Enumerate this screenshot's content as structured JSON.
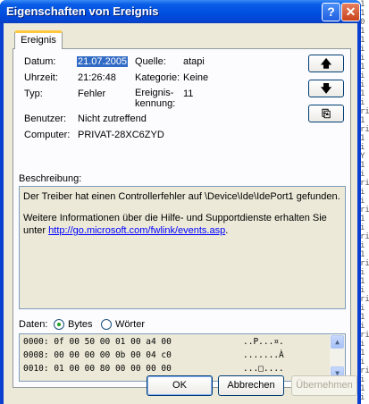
{
  "window": {
    "title": "Eigenschaften von Ereignis",
    "help_glyph": "?",
    "close_glyph": "✕"
  },
  "tab": {
    "label": "Ereignis"
  },
  "fields": {
    "datum_label": "Datum:",
    "datum_value": "21.07.2005",
    "quelle_label": "Quelle:",
    "quelle_value": "atapi",
    "uhrzeit_label": "Uhrzeit:",
    "uhrzeit_value": "21:26:48",
    "kategorie_label": "Kategorie:",
    "kategorie_value": "Keine",
    "typ_label": "Typ:",
    "typ_value": "Fehler",
    "kennung_label_1": "Ereignis-",
    "kennung_label_2": "kennung:",
    "kennung_value": "11",
    "benutzer_label": "Benutzer:",
    "benutzer_value": "Nicht zutreffend",
    "computer_label": "Computer:",
    "computer_value": "PRIVAT-28XC6ZYD"
  },
  "nav": {
    "up": "🡅",
    "down": "🡇",
    "copy": "⎘"
  },
  "description": {
    "label": "Beschreibung:",
    "line1": "Der Treiber hat einen Controllerfehler auf \\Device\\Ide\\IdePort1 gefunden.",
    "line2": "Weitere Informationen über die Hilfe- und Supportdienste erhalten Sie",
    "line3_prefix": "unter ",
    "link": "http://go.microsoft.com/fwlink/events.asp",
    "line3_suffix": "."
  },
  "data": {
    "label": "Daten:",
    "bytes_label": "Bytes",
    "words_label": "Wörter",
    "selected": "Bytes",
    "rows": [
      {
        "hex": "0000: 0f 00 50 00 01 00 a4 00",
        "ascii": "..P...¤."
      },
      {
        "hex": "0008: 00 00 00 00 0b 00 04 c0",
        "ascii": ".......À"
      },
      {
        "hex": "0010: 01 00 00 80 00 00 00 00",
        "ascii": "...□...."
      }
    ]
  },
  "buttons": {
    "ok": "OK",
    "cancel": "Abbrechen",
    "apply": "Übernehmen"
  },
  "colors": {
    "title_blue": "#0050e0",
    "selection": "#316ac5",
    "link": "#0000ff"
  }
}
